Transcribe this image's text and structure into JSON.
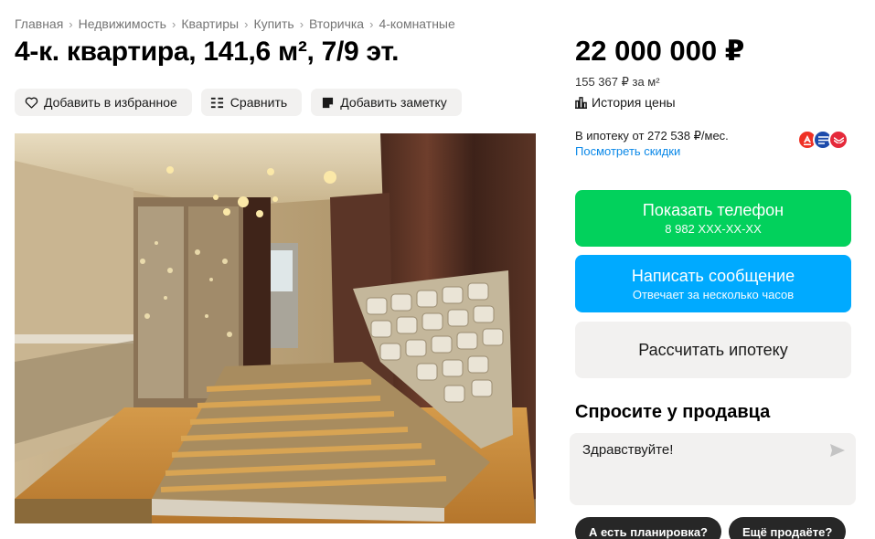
{
  "breadcrumb": [
    "Главная",
    "Недвижимость",
    "Квартиры",
    "Купить",
    "Вторичка",
    "4-комнатные"
  ],
  "title": "4-к. квартира, 141,6 м², 7/9 эт.",
  "actions": {
    "favorite": "Добавить в избранное",
    "compare": "Сравнить",
    "note": "Добавить заметку"
  },
  "price": {
    "total": "22 000 000 ₽",
    "per_m2": "155 367 ₽ за м²",
    "history": "История цены"
  },
  "mortgage": {
    "text": "В ипотеку от 272 538 ₽/мес.",
    "discounts_link": "Посмотреть скидки",
    "bank_colors": [
      "#ef3124",
      "#1d4bab",
      "#e5293a"
    ]
  },
  "contact": {
    "phone_label": "Показать телефон",
    "phone_number": "8 982 XXX-XX-XX",
    "message_label": "Написать сообщение",
    "message_sub": "Отвечает за несколько часов",
    "calc_label": "Рассчитать ипотеку"
  },
  "ask": {
    "title": "Спросите у продавца",
    "input_value": "Здравствуйте!",
    "chips": [
      "А есть планировка?",
      "Ещё продаёте?"
    ]
  },
  "colors": {
    "green": "#02d15c",
    "blue": "#00aaff",
    "link": "#0a88e8",
    "chip": "#272727"
  }
}
